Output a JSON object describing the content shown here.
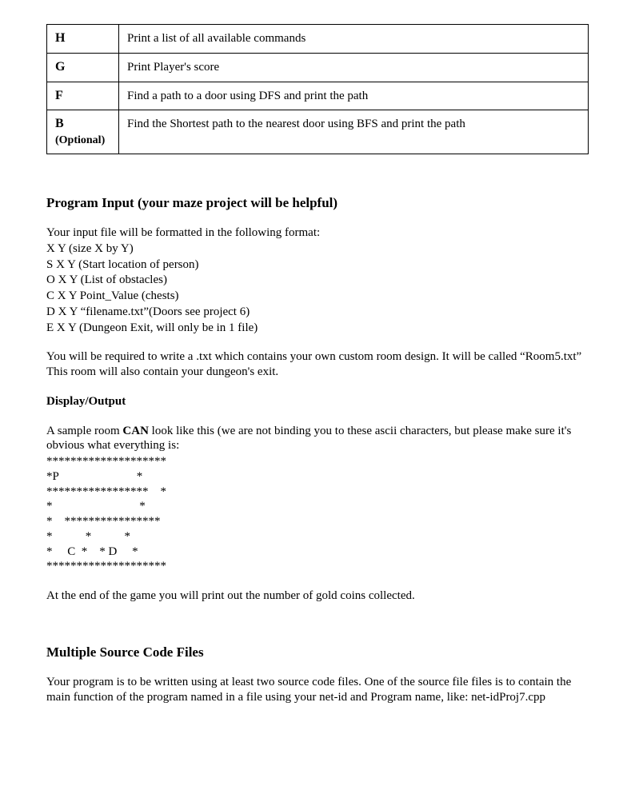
{
  "table": {
    "rows": [
      {
        "cmd": "H",
        "optional": "",
        "desc": "Print a list of all available commands"
      },
      {
        "cmd": "G",
        "optional": "",
        "desc": "Print Player's score"
      },
      {
        "cmd": "F",
        "optional": "",
        "desc": "Find a path to a door using DFS and print the path"
      },
      {
        "cmd": "B",
        "optional": "(Optional)",
        "desc": "Find the Shortest path to the nearest door using BFS and print the path"
      }
    ]
  },
  "section_input": {
    "heading": "Program Input (your maze project will be helpful)",
    "intro": "Your input file will be formatted in the following format:",
    "lines": [
      "X Y (size X by Y)",
      "S X Y (Start location of person)",
      "O X Y (List of obstacles)",
      "C X Y Point_Value (chests)",
      "D X Y “filename.txt”(Doors see project 6)",
      "E X Y (Dungeon Exit, will only be in 1 file)"
    ],
    "custom_room": "You will be required to write a .txt which contains your own custom room design. It will be called “Room5.txt” This room will also contain your dungeon's exit."
  },
  "section_display": {
    "heading": "Display/Output",
    "intro_pre": "A sample room ",
    "intro_bold": "CAN",
    "intro_post": " look like this (we are not binding you to these ascii characters, but please make sure it's obvious what everything is:",
    "ascii": "********************\n*P                          *\n*****************    *\n*                             *\n*    ****************\n*           *           *\n*     C  *    * D     *\n********************",
    "end_note": "At the end of the game you will print out the number of gold coins collected."
  },
  "section_files": {
    "heading": "Multiple Source Code Files",
    "body": "Your program is to be written using at least two source code files. One of the source file files is to contain the main function of the program named in a file using your net-id and Program name, like: net-idProj7.cpp"
  }
}
